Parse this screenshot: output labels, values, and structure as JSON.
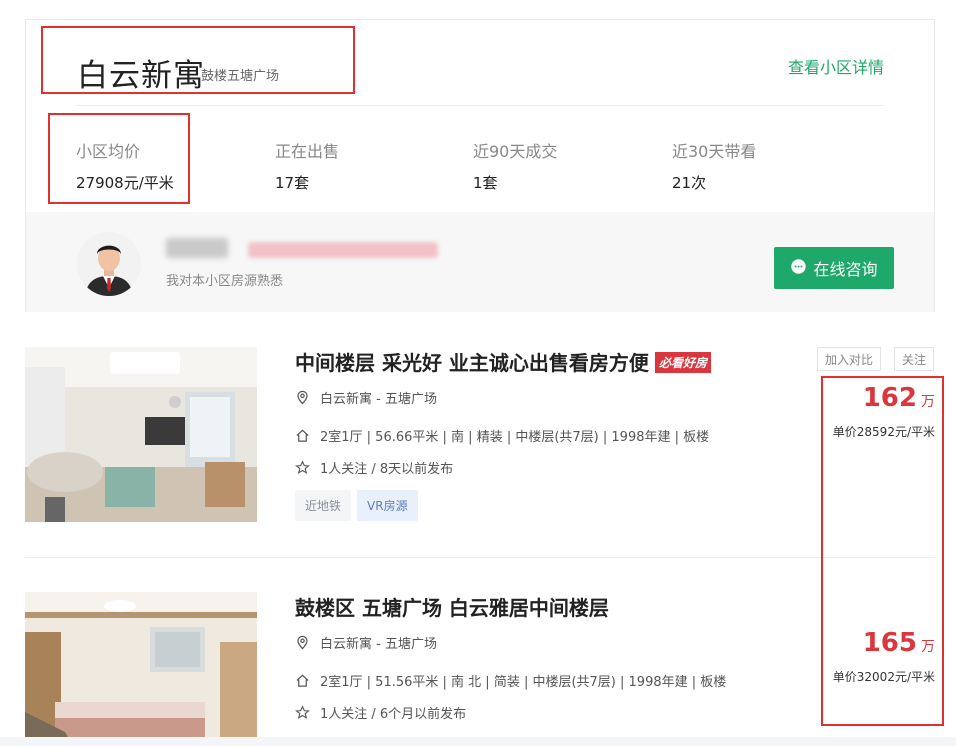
{
  "community": {
    "name": "白云新寓",
    "location": "鼓楼五塘广场",
    "detail_link": "查看小区详情",
    "stats": [
      {
        "label": "小区均价",
        "value": "27908元/平米"
      },
      {
        "label": "正在出售",
        "value": "17套"
      },
      {
        "label": "近90天成交",
        "value": "1套"
      },
      {
        "label": "近30天带看",
        "value": "21次"
      }
    ],
    "agent": {
      "description": "我对本小区房源熟悉",
      "consult_button": "在线咨询"
    }
  },
  "listings": [
    {
      "title": "中间楼层 采光好 业主诚心出售看房方便",
      "badge": "必看好房",
      "address": "白云新寓 - 五塘广场",
      "info": "2室1厅 | 56.66平米 | 南 | 精装 | 中楼层(共7层) | 1998年建 | 板楼",
      "follow": "1人关注 / 8天以前发布",
      "tags": [
        "近地铁",
        "VR房源"
      ],
      "compare_button": "加入对比",
      "follow_button": "关注",
      "price_total": "162",
      "price_unit": "万",
      "price_per": "单价28592元/平米"
    },
    {
      "title": "鼓楼区 五塘广场 白云雅居中间楼层",
      "address": "白云新寓 - 五塘广场",
      "info": "2室1厅 | 51.56平米 | 南 北 | 简装 | 中楼层(共7层) | 1998年建 | 板楼",
      "follow": "1人关注 / 6个月以前发布",
      "price_total": "165",
      "price_unit": "万",
      "price_per": "单价32002元/平米"
    }
  ],
  "colors": {
    "accent_green": "#1ea86a",
    "price_red": "#d9363e",
    "annotation_red": "#e0312f"
  }
}
